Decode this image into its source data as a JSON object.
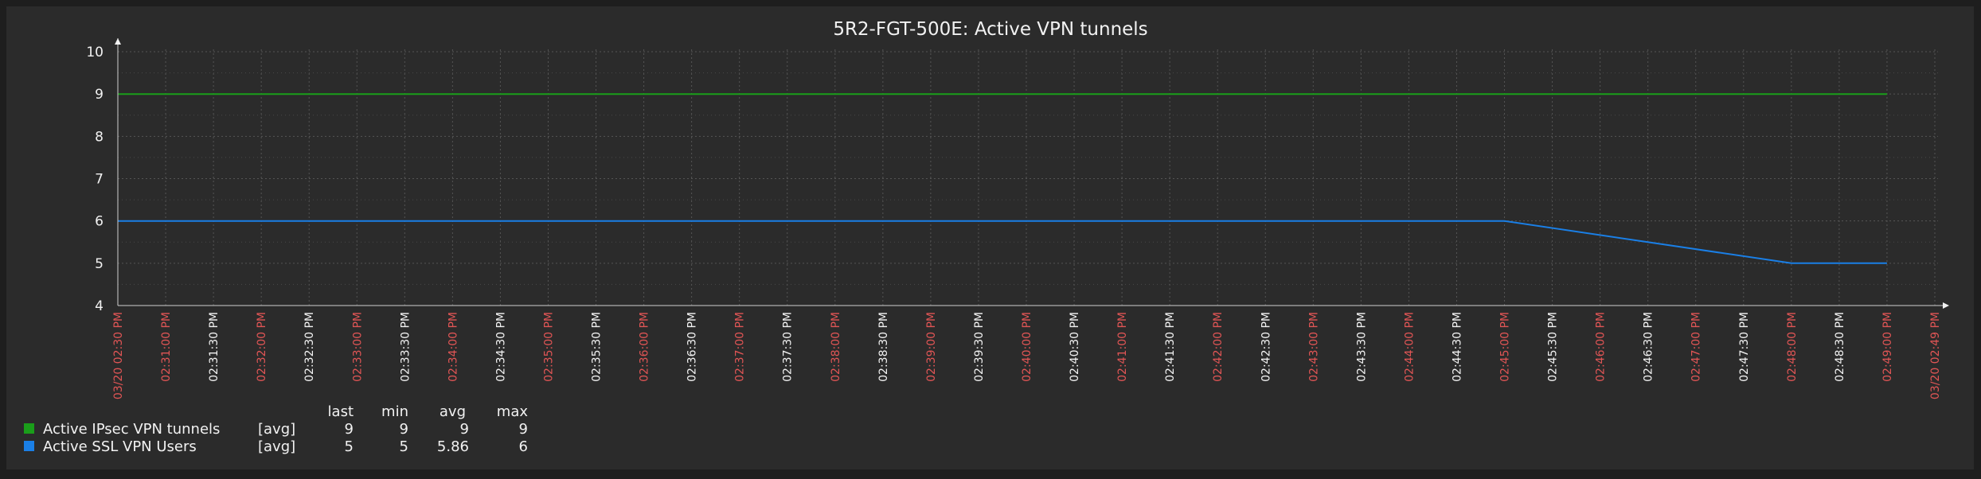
{
  "chart_data": {
    "type": "line",
    "title": "5R2-FGT-500E: Active VPN tunnels",
    "ylim": [
      4,
      10
    ],
    "yticks": [
      4,
      5,
      6,
      7,
      8,
      9,
      10
    ],
    "grid": true,
    "x_ticks": [
      {
        "label": "03/20 02:30 PM",
        "major": true
      },
      {
        "label": "02:31:00 PM",
        "major": true
      },
      {
        "label": "02:31:30 PM",
        "major": false
      },
      {
        "label": "02:32:00 PM",
        "major": true
      },
      {
        "label": "02:32:30 PM",
        "major": false
      },
      {
        "label": "02:33:00 PM",
        "major": true
      },
      {
        "label": "02:33:30 PM",
        "major": false
      },
      {
        "label": "02:34:00 PM",
        "major": true
      },
      {
        "label": "02:34:30 PM",
        "major": false
      },
      {
        "label": "02:35:00 PM",
        "major": true
      },
      {
        "label": "02:35:30 PM",
        "major": false
      },
      {
        "label": "02:36:00 PM",
        "major": true
      },
      {
        "label": "02:36:30 PM",
        "major": false
      },
      {
        "label": "02:37:00 PM",
        "major": true
      },
      {
        "label": "02:37:30 PM",
        "major": false
      },
      {
        "label": "02:38:00 PM",
        "major": true
      },
      {
        "label": "02:38:30 PM",
        "major": false
      },
      {
        "label": "02:39:00 PM",
        "major": true
      },
      {
        "label": "02:39:30 PM",
        "major": false
      },
      {
        "label": "02:40:00 PM",
        "major": true
      },
      {
        "label": "02:40:30 PM",
        "major": false
      },
      {
        "label": "02:41:00 PM",
        "major": true
      },
      {
        "label": "02:41:30 PM",
        "major": false
      },
      {
        "label": "02:42:00 PM",
        "major": true
      },
      {
        "label": "02:42:30 PM",
        "major": false
      },
      {
        "label": "02:43:00 PM",
        "major": true
      },
      {
        "label": "02:43:30 PM",
        "major": false
      },
      {
        "label": "02:44:00 PM",
        "major": true
      },
      {
        "label": "02:44:30 PM",
        "major": false
      },
      {
        "label": "02:45:00 PM",
        "major": true
      },
      {
        "label": "02:45:30 PM",
        "major": false
      },
      {
        "label": "02:46:00 PM",
        "major": true
      },
      {
        "label": "02:46:30 PM",
        "major": false
      },
      {
        "label": "02:47:00 PM",
        "major": true
      },
      {
        "label": "02:47:30 PM",
        "major": false
      },
      {
        "label": "02:48:00 PM",
        "major": true
      },
      {
        "label": "02:48:30 PM",
        "major": false
      },
      {
        "label": "02:49:00 PM",
        "major": true
      },
      {
        "label": "03/20 02:49 PM",
        "major": true
      }
    ],
    "series": [
      {
        "name": "Active IPsec VPN tunnels",
        "func": "[avg]",
        "color": "#1a9e1a",
        "points": [
          {
            "x": "02:30:00 PM",
            "y": 9
          },
          {
            "x": "02:49:00 PM",
            "y": 9
          }
        ],
        "last": "9",
        "min": "9",
        "avg": "9",
        "max": "9"
      },
      {
        "name": "Active SSL VPN Users",
        "func": "[avg]",
        "color": "#1a7fe6",
        "points": [
          {
            "x": "02:30:00 PM",
            "y": 6
          },
          {
            "x": "02:45:00 PM",
            "y": 6
          },
          {
            "x": "02:48:00 PM",
            "y": 5
          },
          {
            "x": "02:49:00 PM",
            "y": 5
          }
        ],
        "last": "5",
        "min": "5",
        "avg": "5.86",
        "max": "6"
      }
    ],
    "legend_headers": {
      "last": "last",
      "min": "min",
      "avg": "avg",
      "max": "max"
    },
    "colors": {
      "major_tick_label": "#e05555",
      "minor_tick_label": "#f2f2f2",
      "grid": "#555555",
      "axis": "#cfcfcf"
    }
  }
}
